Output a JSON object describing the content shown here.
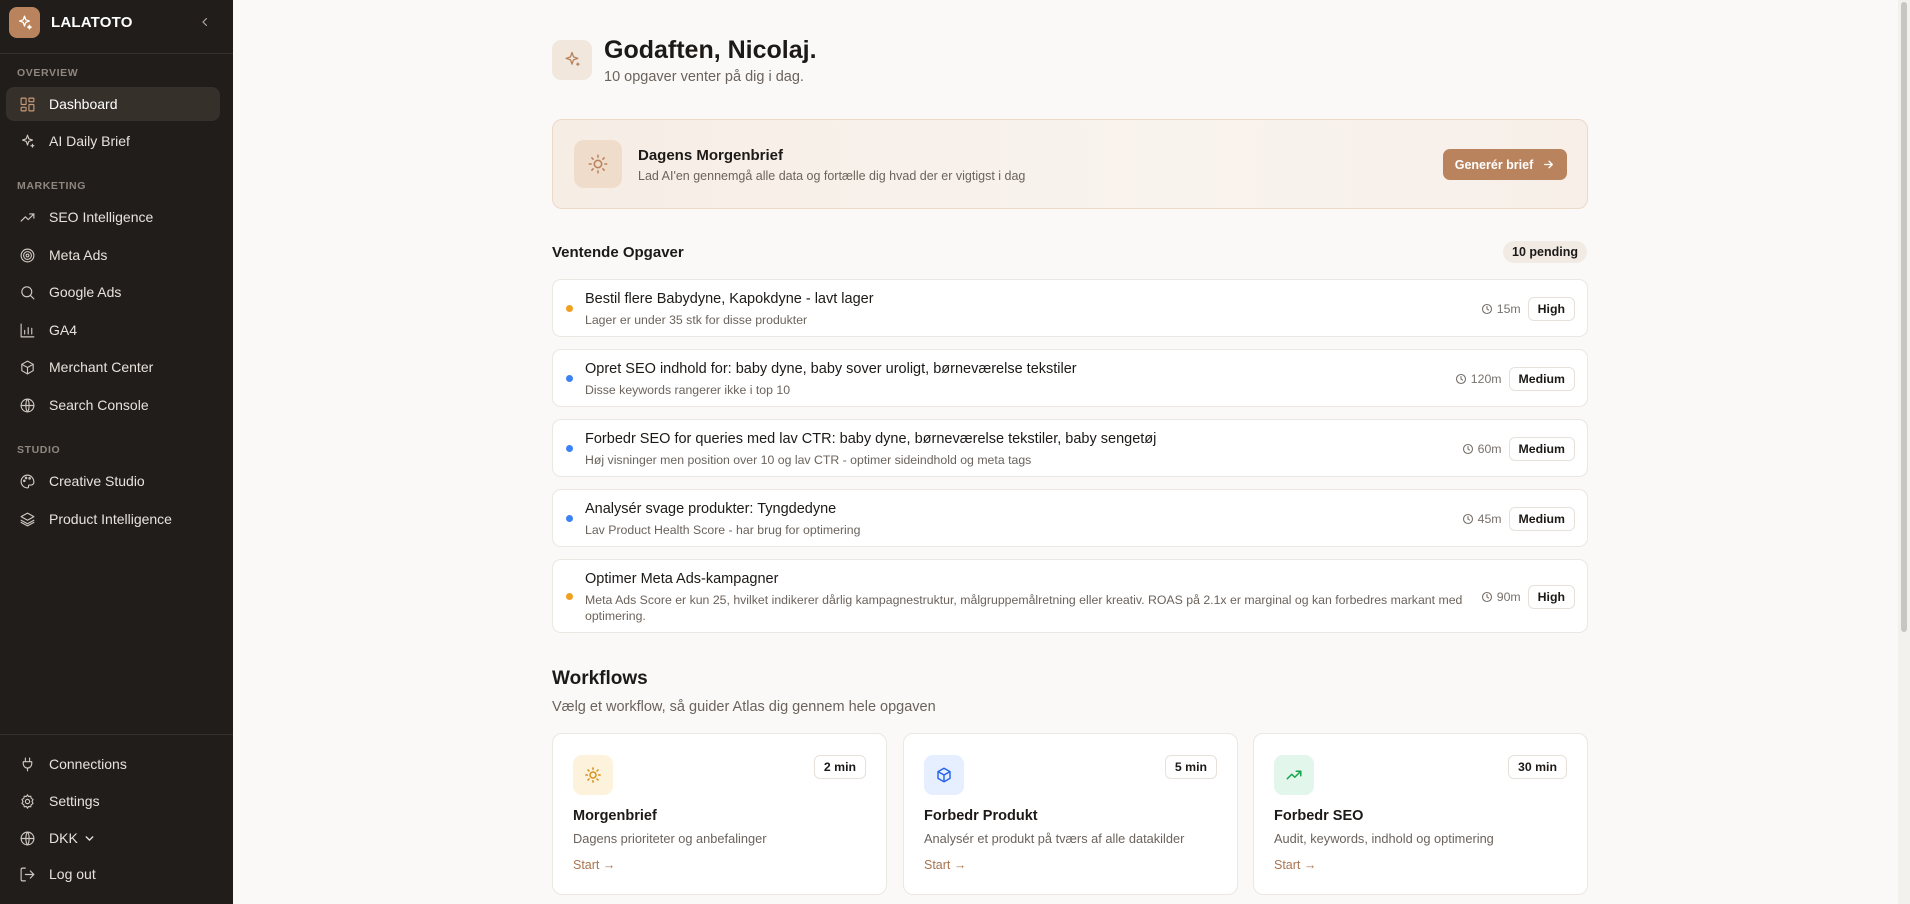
{
  "colors": {
    "accent": "#b9845d",
    "sidebar_bg": "#211d1a",
    "priority_high": "#f0a01e",
    "priority_medium": "#3b82f6"
  },
  "sidebar": {
    "brand": "LALATOTO",
    "sections": [
      {
        "label": "OVERVIEW",
        "items": [
          {
            "label": "Dashboard",
            "icon": "dashboard-grid-icon",
            "active": true
          },
          {
            "label": "AI Daily Brief",
            "icon": "sparkle-icon"
          }
        ]
      },
      {
        "label": "MARKETING",
        "items": [
          {
            "label": "SEO Intelligence",
            "icon": "trending-up-icon"
          },
          {
            "label": "Meta Ads",
            "icon": "target-icon"
          },
          {
            "label": "Google Ads",
            "icon": "search-icon"
          },
          {
            "label": "GA4",
            "icon": "bar-chart-icon"
          },
          {
            "label": "Merchant Center",
            "icon": "package-icon"
          },
          {
            "label": "Search Console",
            "icon": "globe-icon"
          }
        ]
      },
      {
        "label": "STUDIO",
        "items": [
          {
            "label": "Creative Studio",
            "icon": "palette-icon"
          },
          {
            "label": "Product Intelligence",
            "icon": "layers-icon"
          }
        ]
      }
    ],
    "bottom": [
      {
        "label": "Connections",
        "icon": "plug-icon"
      },
      {
        "label": "Settings",
        "icon": "gear-icon"
      },
      {
        "label": "DKK",
        "icon": "globe-icon"
      },
      {
        "label": "Log out",
        "icon": "logout-icon"
      }
    ]
  },
  "greeting": {
    "title": "Godaften, Nicolaj.",
    "subtitle": "10 opgaver venter på dig i dag."
  },
  "brief": {
    "title": "Dagens Morgenbrief",
    "subtitle": "Lad AI'en gennemgå alle data og fortælle dig hvad der er vigtigst i dag",
    "button": "Generér brief"
  },
  "pending": {
    "title": "Ventende Opgaver",
    "badge": "10 pending"
  },
  "tasks": [
    {
      "title": "Bestil flere Babydyne, Kapokdyne - lavt lager",
      "subtitle": "Lager er under 35 stk for disse produkter",
      "time": "15m",
      "priority": "High"
    },
    {
      "title": "Opret SEO indhold for: baby dyne, baby sover uroligt, børneværelse tekstiler",
      "subtitle": "Disse keywords rangerer ikke i top 10",
      "time": "120m",
      "priority": "Medium"
    },
    {
      "title": "Forbedr SEO for queries med lav CTR: baby dyne, børneværelse tekstiler, baby sengetøj",
      "subtitle": "Høj visninger men position over 10 og lav CTR - optimer sideindhold og meta tags",
      "time": "60m",
      "priority": "Medium"
    },
    {
      "title": "Analysér svage produkter: Tyngdedyne",
      "subtitle": "Lav Product Health Score - har brug for optimering",
      "time": "45m",
      "priority": "Medium"
    },
    {
      "title": "Optimer Meta Ads-kampagner",
      "subtitle": "Meta Ads Score er kun 25, hvilket indikerer dårlig kampagnestruktur, målgruppemålretning eller kreativ. ROAS på 2.1x er marginal og kan forbedres markant med optimering.",
      "time": "90m",
      "priority": "High"
    }
  ],
  "workflows": {
    "title": "Workflows",
    "subtitle": "Vælg et workflow, så guider Atlas dig gennem hele opgaven",
    "items": [
      {
        "name": "Morgenbrief",
        "desc": "Dagens prioriteter og anbefalinger",
        "duration": "2 min",
        "start": "Start →",
        "icon": "sun-icon"
      },
      {
        "name": "Forbedr Produkt",
        "desc": "Analysér et produkt på tværs af alle datakilder",
        "duration": "5 min",
        "start": "Start →",
        "icon": "package-icon"
      },
      {
        "name": "Forbedr SEO",
        "desc": "Audit, keywords, indhold og optimering",
        "duration": "30 min",
        "start": "Start →",
        "icon": "trending-up-icon"
      }
    ]
  }
}
